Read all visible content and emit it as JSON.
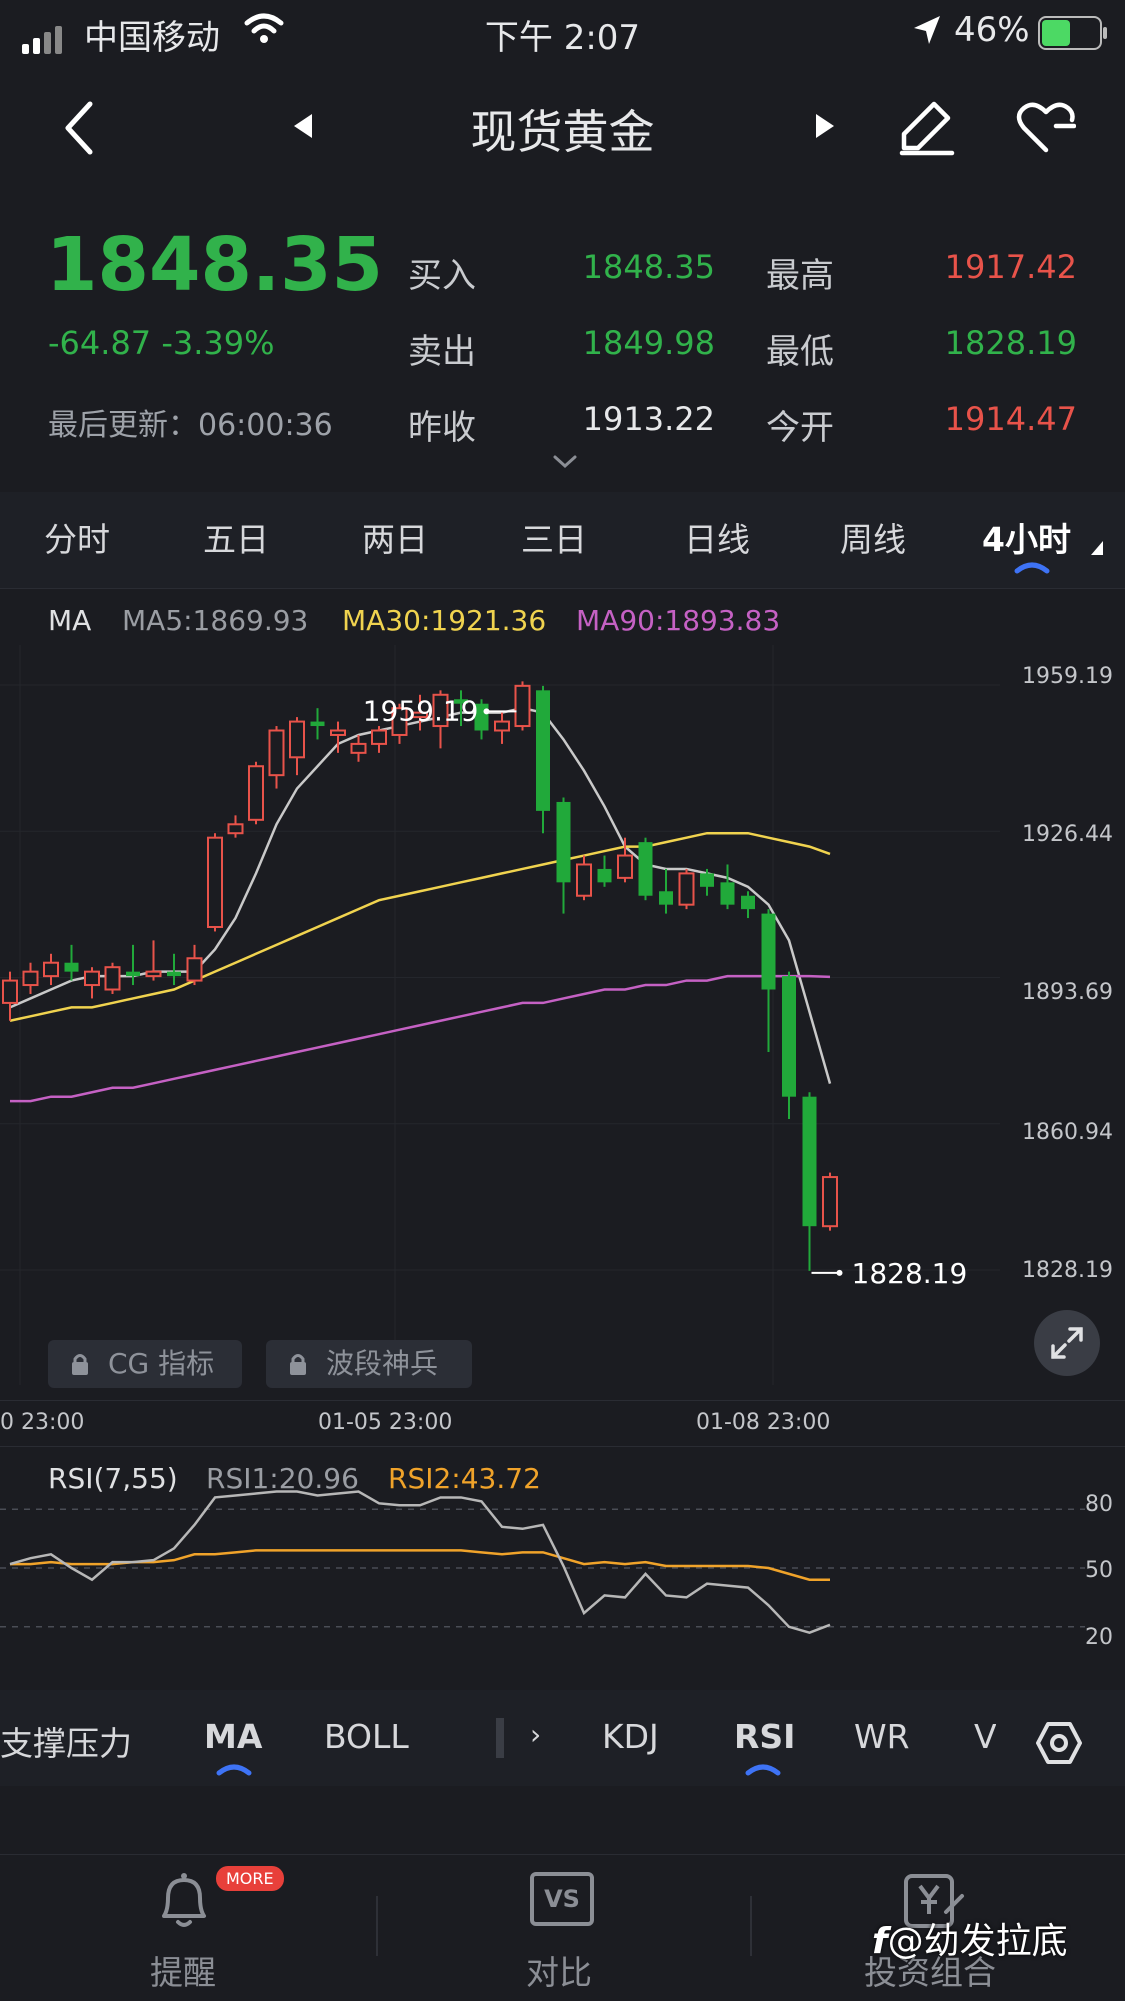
{
  "status_bar": {
    "carrier": "中国移动",
    "time": "下午 2:07",
    "battery": "46%"
  },
  "header": {
    "title": "现货黄金"
  },
  "quote": {
    "price": "1848.35",
    "change": "-64.87 -3.39%",
    "last_update": "最后更新：06:00:36",
    "fields": {
      "buy_label": "买入",
      "buy_value": "1848.35",
      "sell_label": "卖出",
      "sell_value": "1849.98",
      "prev_close_label": "昨收",
      "prev_close_value": "1913.22",
      "high_label": "最高",
      "high_value": "1917.42",
      "low_label": "最低",
      "low_value": "1828.19",
      "open_label": "今开",
      "open_value": "1914.47"
    }
  },
  "period_tabs": [
    "分时",
    "五日",
    "两日",
    "三日",
    "日线",
    "周线",
    "4小时"
  ],
  "active_period": "4小时",
  "ma_legend": {
    "ma": "MA",
    "ma5": "MA5:1869.93",
    "ma30": "MA30:1921.36",
    "ma90": "MA90:1893.83"
  },
  "colors": {
    "up": "#e8534a",
    "down": "#21a93a",
    "ma5": "#c9c9c9",
    "ma30": "#f0d34f",
    "ma90": "#c561c4",
    "rsi1": "#b7b7b7",
    "rsi2": "#f0a32a",
    "accent": "#3e73f5"
  },
  "chart_data": {
    "type": "candlestick",
    "y_axis_ticks": [
      "1959.19",
      "1926.44",
      "1893.69",
      "1860.94",
      "1828.19"
    ],
    "ylim": [
      1828.19,
      1959.19
    ],
    "x_axis_ticks": [
      "0 23:00",
      "01-05 23:00",
      "01-08 23:00"
    ],
    "annotations": {
      "high": "1959.19",
      "low": "1828.19"
    },
    "candles": [
      {
        "o": 1888,
        "c": 1893,
        "h": 1895,
        "l": 1884
      },
      {
        "o": 1892,
        "c": 1895,
        "h": 1897,
        "l": 1890
      },
      {
        "o": 1894,
        "c": 1897,
        "h": 1899,
        "l": 1892
      },
      {
        "o": 1897,
        "c": 1895,
        "h": 1901,
        "l": 1893
      },
      {
        "o": 1892,
        "c": 1895,
        "h": 1896,
        "l": 1889
      },
      {
        "o": 1891,
        "c": 1896,
        "h": 1897,
        "l": 1890
      },
      {
        "o": 1895,
        "c": 1894,
        "h": 1901,
        "l": 1892
      },
      {
        "o": 1894,
        "c": 1895,
        "h": 1902,
        "l": 1893
      },
      {
        "o": 1895,
        "c": 1894,
        "h": 1899,
        "l": 1892
      },
      {
        "o": 1893,
        "c": 1898,
        "h": 1901,
        "l": 1892
      },
      {
        "o": 1905,
        "c": 1925,
        "h": 1926,
        "l": 1904
      },
      {
        "o": 1926,
        "c": 1928,
        "h": 1930,
        "l": 1925
      },
      {
        "o": 1929,
        "c": 1941,
        "h": 1942,
        "l": 1928
      },
      {
        "o": 1939,
        "c": 1949,
        "h": 1950,
        "l": 1936
      },
      {
        "o": 1943,
        "c": 1951,
        "h": 1952,
        "l": 1939
      },
      {
        "o": 1951,
        "c": 1950,
        "h": 1954,
        "l": 1947
      },
      {
        "o": 1948,
        "c": 1949,
        "h": 1951,
        "l": 1944
      },
      {
        "o": 1944,
        "c": 1946,
        "h": 1948,
        "l": 1942
      },
      {
        "o": 1946,
        "c": 1949,
        "h": 1950,
        "l": 1944
      },
      {
        "o": 1948,
        "c": 1954,
        "h": 1955,
        "l": 1946
      },
      {
        "o": 1952,
        "c": 1953,
        "h": 1957,
        "l": 1949
      },
      {
        "o": 1950,
        "c": 1957,
        "h": 1958,
        "l": 1945
      },
      {
        "o": 1956,
        "c": 1955,
        "h": 1958,
        "l": 1950
      },
      {
        "o": 1955,
        "c": 1949,
        "h": 1956,
        "l": 1947
      },
      {
        "o": 1949,
        "c": 1951,
        "h": 1953,
        "l": 1946
      },
      {
        "o": 1950,
        "c": 1959,
        "h": 1960,
        "l": 1949
      },
      {
        "o": 1958,
        "c": 1931,
        "h": 1959,
        "l": 1926
      },
      {
        "o": 1933,
        "c": 1915,
        "h": 1934,
        "l": 1908
      },
      {
        "o": 1912,
        "c": 1919,
        "h": 1921,
        "l": 1911
      },
      {
        "o": 1918,
        "c": 1915,
        "h": 1921,
        "l": 1914
      },
      {
        "o": 1916,
        "c": 1921,
        "h": 1925,
        "l": 1915
      },
      {
        "o": 1924,
        "c": 1912,
        "h": 1925,
        "l": 1911
      },
      {
        "o": 1913,
        "c": 1910,
        "h": 1918,
        "l": 1908
      },
      {
        "o": 1910,
        "c": 1917,
        "h": 1918,
        "l": 1909
      },
      {
        "o": 1917,
        "c": 1914,
        "h": 1918,
        "l": 1912
      },
      {
        "o": 1915,
        "c": 1910,
        "h": 1919,
        "l": 1909
      },
      {
        "o": 1912,
        "c": 1909,
        "h": 1913,
        "l": 1907
      },
      {
        "o": 1908,
        "c": 1891,
        "h": 1909,
        "l": 1877
      },
      {
        "o": 1894,
        "c": 1867,
        "h": 1895,
        "l": 1862
      },
      {
        "o": 1867,
        "c": 1838,
        "h": 1868,
        "l": 1828
      },
      {
        "o": 1838,
        "c": 1849,
        "h": 1850,
        "l": 1837
      }
    ],
    "ma_lines": {
      "MA5": [
        1887,
        1889,
        1891,
        1893,
        1894,
        1894,
        1894,
        1895,
        1895,
        1895,
        1900,
        1907,
        1917,
        1928,
        1936,
        1941,
        1946,
        1948,
        1949,
        1950,
        1951,
        1952,
        1953,
        1953,
        1953,
        1954,
        1953,
        1947,
        1940,
        1932,
        1923,
        1919,
        1918,
        1918,
        1917,
        1916,
        1914,
        1910,
        1902,
        1886,
        1869.93
      ],
      "MA30": [
        1884,
        1885,
        1886,
        1887,
        1887,
        1888,
        1889,
        1890,
        1891,
        1893,
        1895,
        1897,
        1899,
        1901,
        1903,
        1905,
        1907,
        1909,
        1911,
        1912,
        1913,
        1914,
        1915,
        1916,
        1917,
        1918,
        1919,
        1920,
        1921,
        1922,
        1923,
        1923,
        1924,
        1925,
        1926,
        1926,
        1926,
        1925,
        1924,
        1923,
        1921.36
      ],
      "MA90": [
        1866,
        1866,
        1867,
        1867,
        1868,
        1869,
        1869,
        1870,
        1871,
        1872,
        1873,
        1874,
        1875,
        1876,
        1877,
        1878,
        1879,
        1880,
        1881,
        1882,
        1883,
        1884,
        1885,
        1886,
        1887,
        1888,
        1888,
        1889,
        1890,
        1891,
        1891,
        1892,
        1892,
        1893,
        1893,
        1894,
        1894,
        1894,
        1894,
        1894,
        1893.83
      ]
    }
  },
  "overlay_buttons": {
    "cg": "CG 指标",
    "wave": "波段神兵"
  },
  "rsi": {
    "title": "RSI(7,55)",
    "rsi1": "RSI1:20.96",
    "rsi2": "RSI2:43.72",
    "levels": [
      "80",
      "50",
      "20"
    ],
    "rsi1_values": [
      52,
      55,
      57,
      50,
      44,
      53,
      53,
      54,
      60,
      72,
      86,
      87,
      88,
      89,
      89,
      87,
      88,
      89,
      83,
      82,
      82,
      86,
      86,
      84,
      71,
      70,
      72,
      51,
      27,
      36,
      35,
      47,
      36,
      35,
      42,
      41,
      40,
      31,
      20,
      17,
      21
    ],
    "rsi2_values": [
      52,
      52,
      53,
      52,
      52,
      52,
      53,
      53,
      54,
      57,
      57,
      58,
      59,
      59,
      59,
      59,
      59,
      59,
      59,
      59,
      59,
      59,
      59,
      58,
      57,
      58,
      58,
      55,
      52,
      53,
      52,
      53,
      51,
      51,
      51,
      51,
      51,
      50,
      47,
      44,
      44
    ]
  },
  "indicator_tabs": [
    "支撑压力",
    "MA",
    "BOLL",
    "KDJ",
    "RSI",
    "WR",
    "V"
  ],
  "bottom_nav": {
    "alert": "提醒",
    "more_badge": "MORE",
    "compare": "对比",
    "compare_icon_text": "VS",
    "portfolio": "投资组合",
    "watermark": "@幼发拉底"
  }
}
